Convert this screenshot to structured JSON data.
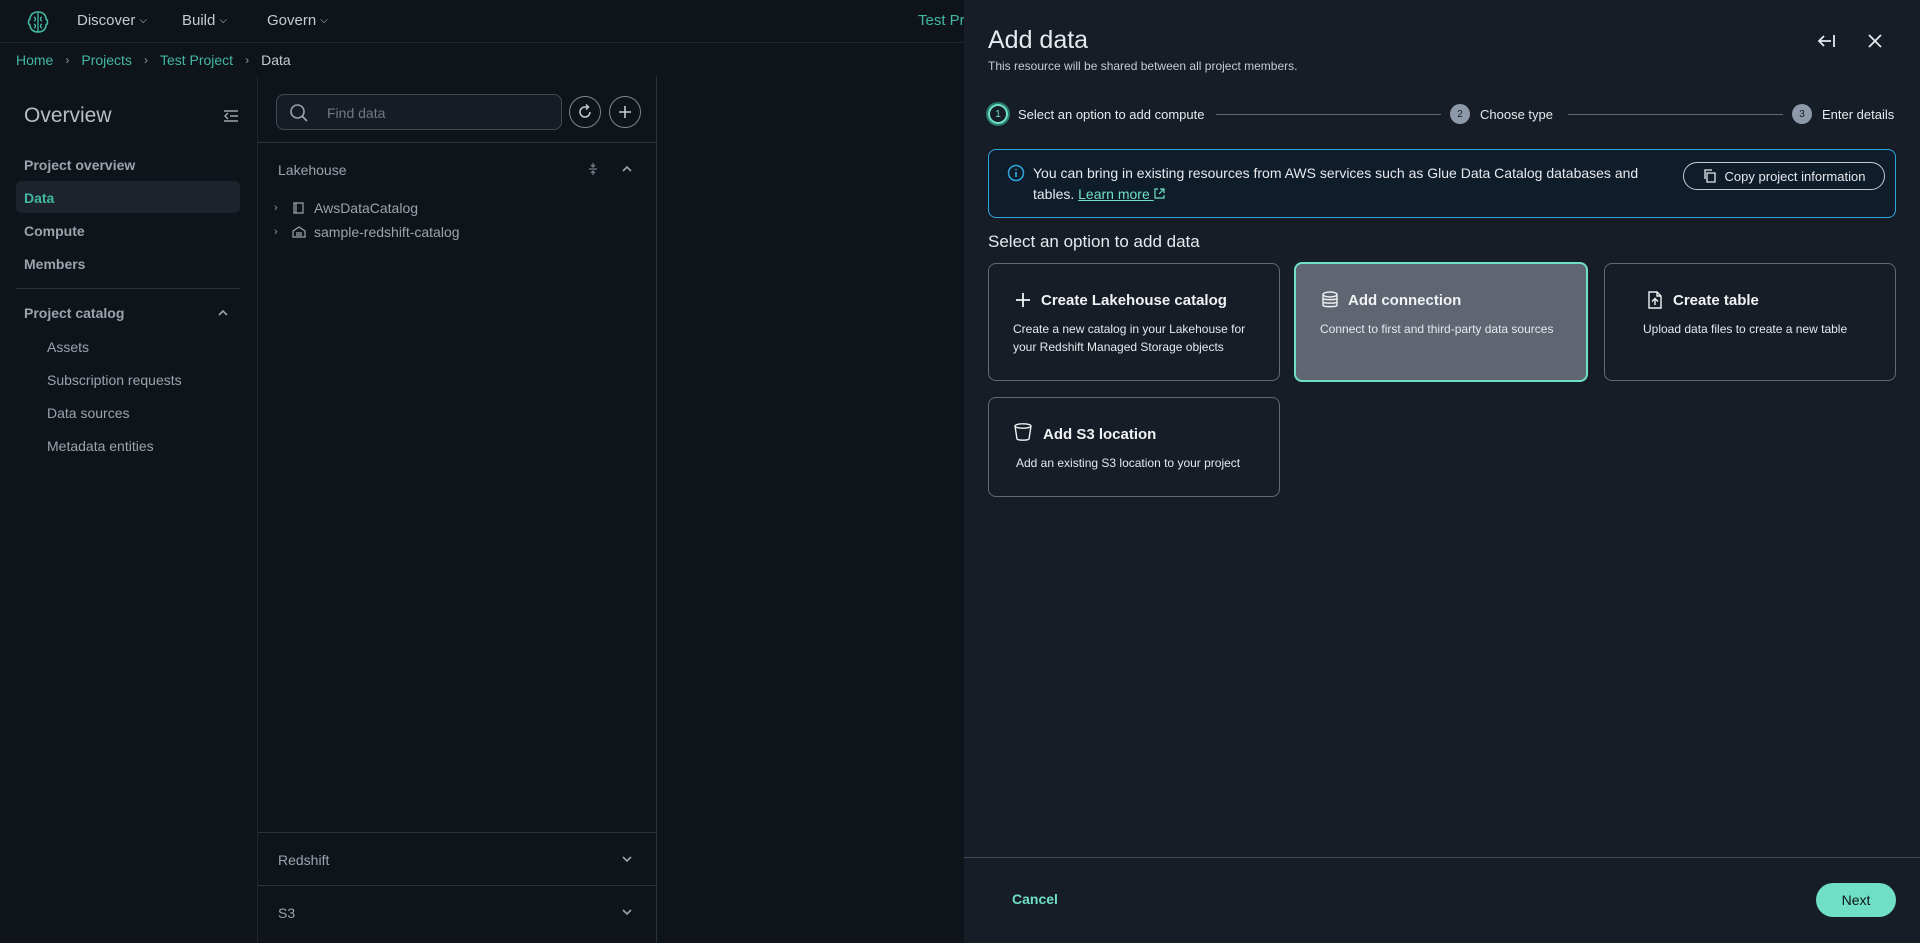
{
  "topnav": {
    "menus": [
      {
        "label": "Discover"
      },
      {
        "label": "Build"
      },
      {
        "label": "Govern"
      }
    ],
    "project_name": "Test Pr"
  },
  "breadcrumb": {
    "items": [
      "Home",
      "Projects",
      "Test Project"
    ],
    "current": "Data"
  },
  "sidebar": {
    "title": "Overview",
    "items": [
      "Project overview",
      "Data",
      "Compute",
      "Members"
    ],
    "active": "Data",
    "catalog_title": "Project catalog",
    "catalog_items": [
      "Assets",
      "Subscription requests",
      "Data sources",
      "Metadata entities"
    ]
  },
  "data_panel": {
    "search_placeholder": "Find data",
    "lakehouse_label": "Lakehouse",
    "tree": [
      "AwsDataCatalog",
      "sample-redshift-catalog"
    ],
    "redshift_label": "Redshift",
    "s3_label": "S3"
  },
  "drawer": {
    "title": "Add data",
    "subtitle": "This resource will be shared between all project members.",
    "steps": [
      {
        "num": "1",
        "label": "Select an option to add compute"
      },
      {
        "num": "2",
        "label": "Choose type"
      },
      {
        "num": "3",
        "label": "Enter details"
      }
    ],
    "info": {
      "text": "You can bring in existing resources from AWS services such as Glue Data Catalog databases and tables.",
      "link": "Learn more",
      "copy_button": "Copy project information"
    },
    "section_title": "Select an option to add data",
    "options": [
      {
        "title": "Create Lakehouse catalog",
        "desc": "Create a new catalog in your Lakehouse for your Redshift Managed Storage objects",
        "icon": "plus-icon"
      },
      {
        "title": "Add connection",
        "desc": "Connect to first and third-party data sources",
        "icon": "database-icon"
      },
      {
        "title": "Create table",
        "desc": "Upload data files to create a new table",
        "icon": "file-upload-icon"
      },
      {
        "title": "Add S3 location",
        "desc": "Add an existing S3 location to your project",
        "icon": "bucket-icon"
      }
    ],
    "selected_option": "Add connection",
    "cancel": "Cancel",
    "next": "Next"
  },
  "colors": {
    "accent": "#6fe0c4",
    "link": "#42b8a0",
    "info_border": "#2ea7e0",
    "background": "#0f141a",
    "drawer_bg": "#161d26"
  }
}
